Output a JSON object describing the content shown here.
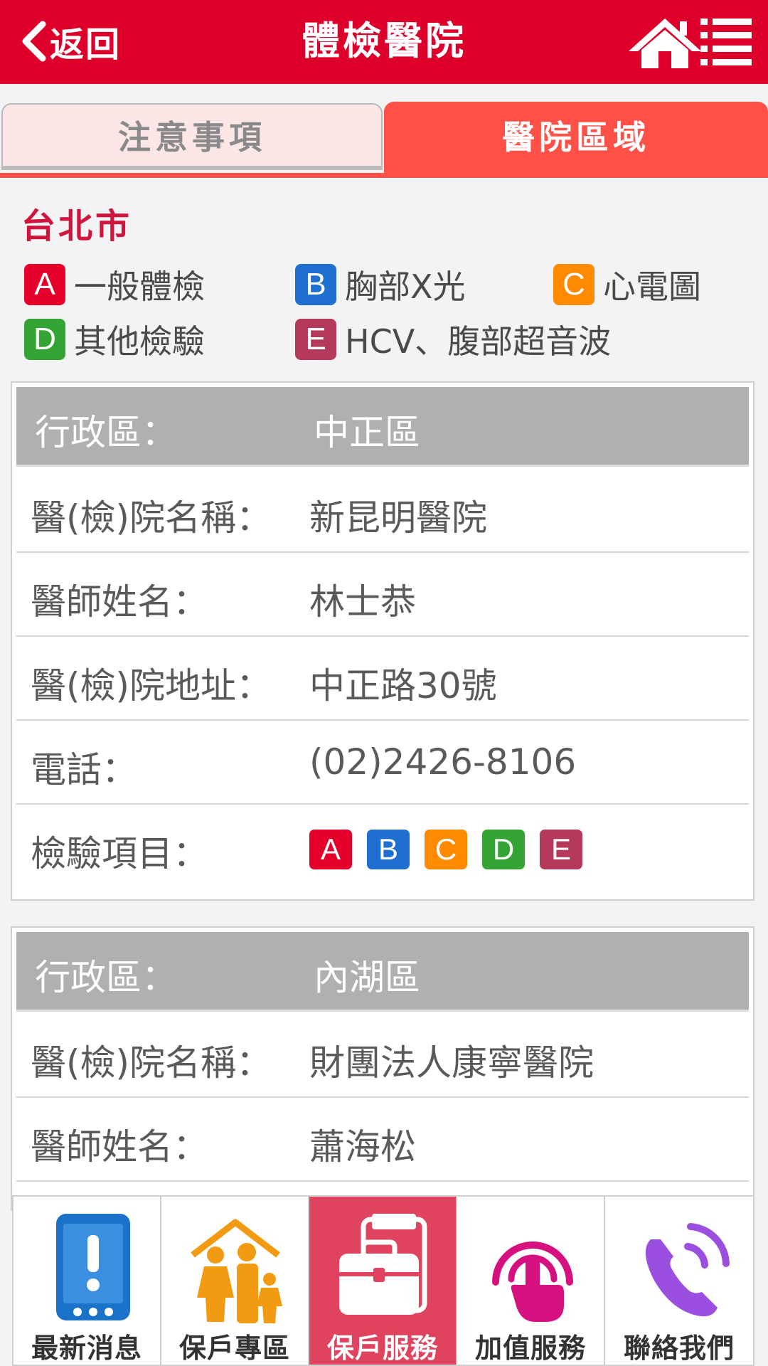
{
  "header": {
    "back_label": "返回",
    "title": "體檢醫院"
  },
  "tabs": [
    {
      "label": "注意事項",
      "active": false
    },
    {
      "label": "醫院區域",
      "active": true
    }
  ],
  "city": "台北市",
  "legend": [
    {
      "code": "A",
      "label": "一般體檢",
      "color": "#e4002b"
    },
    {
      "code": "B",
      "label": "胸部X光",
      "color": "#1f6fd1"
    },
    {
      "code": "C",
      "label": "心電圖",
      "color": "#ff8a00"
    },
    {
      "code": "D",
      "label": "其他檢驗",
      "color": "#34a534"
    },
    {
      "code": "E",
      "label": "HCV、腹部超音波",
      "color": "#b5395a"
    }
  ],
  "labels": {
    "district": "行政區：",
    "hospital_name": "醫(檢)院名稱：",
    "doctor": "醫師姓名：",
    "address": "醫(檢)院地址：",
    "phone": "電話：",
    "items": "檢驗項目："
  },
  "hospitals": [
    {
      "district": "中正區",
      "hospital_name": "新昆明醫院",
      "doctor": "林士恭",
      "address": "中正路30號",
      "phone": "(02)2426-8106",
      "items": [
        "A",
        "B",
        "C",
        "D",
        "E"
      ]
    },
    {
      "district": "內湖區",
      "hospital_name": "財團法人康寧醫院",
      "doctor": "蕭海松"
    }
  ],
  "bottom_nav": [
    {
      "label": "最新消息",
      "icon": "phone-alert-icon",
      "active": false
    },
    {
      "label": "保戶專區",
      "icon": "family-home-icon",
      "active": false
    },
    {
      "label": "保戶服務",
      "icon": "briefcase-icon",
      "active": true
    },
    {
      "label": "加值服務",
      "icon": "touch-icon",
      "active": false
    },
    {
      "label": "聯絡我們",
      "icon": "call-icon",
      "active": false
    }
  ],
  "colors": {
    "brand": "#dc002b",
    "tab_active": "#ff5147",
    "nav_active": "#e0435e"
  }
}
